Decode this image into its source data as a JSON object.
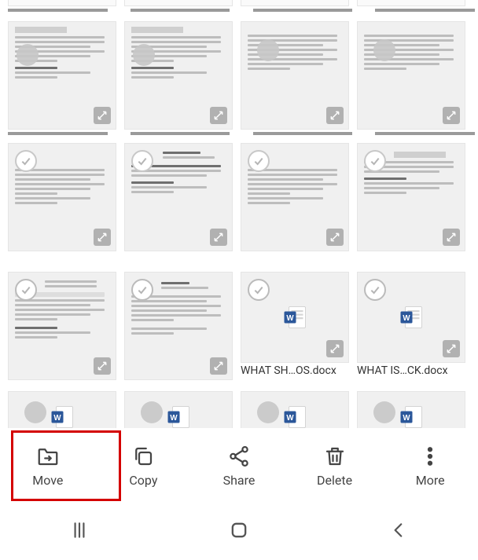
{
  "toolbar": {
    "move": "Move",
    "copy": "Copy",
    "share": "Share",
    "delete": "Delete",
    "more": "More"
  },
  "files": {
    "row3_item3_caption": "WHAT SH…OS.docx",
    "row3_item4_caption": "WHAT IS…CK.docx"
  },
  "nav": {
    "recents": "recents-button",
    "home": "home-button",
    "back": "back-button"
  }
}
